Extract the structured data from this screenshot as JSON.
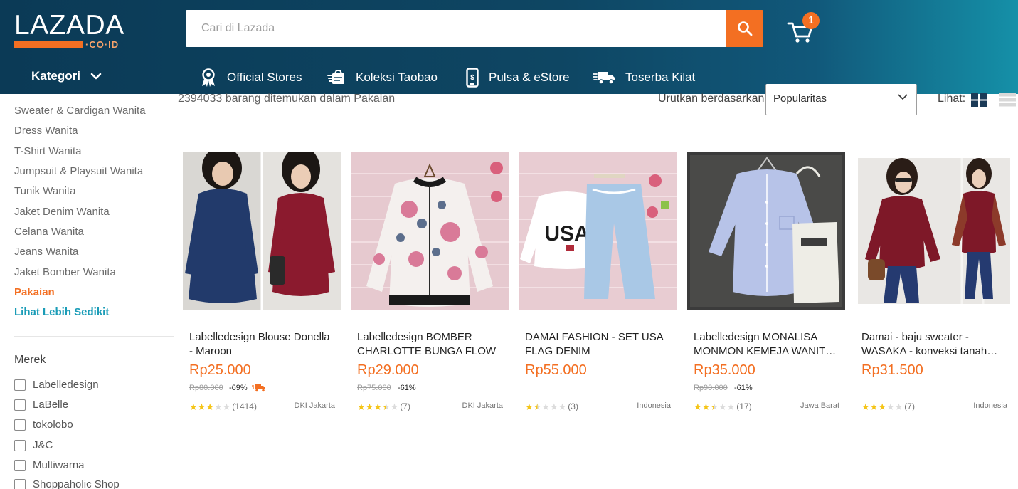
{
  "header": {
    "logo": {
      "word": "LAZADA",
      "sub": "·CO·ID"
    },
    "search": {
      "placeholder": "Cari di Lazada"
    },
    "cart": {
      "count": "1"
    },
    "kategori_label": "Kategori",
    "nav": [
      {
        "label": "Official Stores",
        "icon": "ribbon-icon"
      },
      {
        "label": "Koleksi Taobao",
        "icon": "box-icon"
      },
      {
        "label": "Pulsa & eStore",
        "icon": "phone-icon"
      },
      {
        "label": "Toserba Kilat",
        "icon": "truck-icon"
      }
    ]
  },
  "sidebar": {
    "categories": [
      {
        "label": "Sweater & Cardigan Wanita"
      },
      {
        "label": "Dress Wanita"
      },
      {
        "label": "T-Shirt Wanita"
      },
      {
        "label": "Jumpsuit & Playsuit Wanita"
      },
      {
        "label": "Tunik Wanita"
      },
      {
        "label": "Jaket Denim Wanita"
      },
      {
        "label": "Celana Wanita"
      },
      {
        "label": "Jeans Wanita"
      },
      {
        "label": "Jaket Bomber Wanita"
      },
      {
        "label": "Pakaian"
      }
    ],
    "show_less": "Lihat Lebih Sedikit",
    "brand_title": "Merek",
    "brands": [
      {
        "label": "Labelledesign"
      },
      {
        "label": "LaBelle"
      },
      {
        "label": "tokolobo"
      },
      {
        "label": "J&C"
      },
      {
        "label": "Multiwarna"
      },
      {
        "label": "Shoppaholic Shop"
      }
    ]
  },
  "results": {
    "count_text": "2394033 barang ditemukan dalam Pakaian",
    "sort_label": "Urutkan berdasarkan:",
    "sort_value": "Popularitas",
    "view_label": "Lihat:"
  },
  "products": [
    {
      "title": "Labelledesign Blouse Donella - Maroon",
      "price": "Rp25.000",
      "original_price": "Rp80.000",
      "discount": "-69%",
      "rating": 3,
      "review_count": "(1414)",
      "location": "DKI Jakarta",
      "free_shipping": true
    },
    {
      "title": "Labelledesign BOMBER CHARLOTTE BUNGA FLOW",
      "price": "Rp29.000",
      "original_price": "Rp75.000",
      "discount": "-61%",
      "rating": 3.5,
      "review_count": "(7)",
      "location": "DKI Jakarta",
      "free_shipping": false
    },
    {
      "title": "DAMAI FASHION - SET USA FLAG DENIM",
      "price": "Rp55.000",
      "original_price": "",
      "discount": "",
      "rating": 1.5,
      "review_count": "(3)",
      "location": "Indonesia",
      "free_shipping": false
    },
    {
      "title": "Labelledesign MONALISA MONMON KEMEJA WANIT…",
      "price": "Rp35.000",
      "original_price": "Rp90.000",
      "discount": "-61%",
      "rating": 2.5,
      "review_count": "(17)",
      "location": "Jawa Barat",
      "free_shipping": false
    },
    {
      "title": "Damai - baju sweater - WASAKA - konveksi tanah…",
      "price": "Rp31.500",
      "original_price": "",
      "discount": "",
      "rating": 3,
      "review_count": "(7)",
      "location": "Indonesia",
      "free_shipping": false
    }
  ],
  "colors": {
    "accent": "#f36f22",
    "link": "#1a9cb7",
    "header": "#0e4663",
    "star": "#f5c518"
  }
}
